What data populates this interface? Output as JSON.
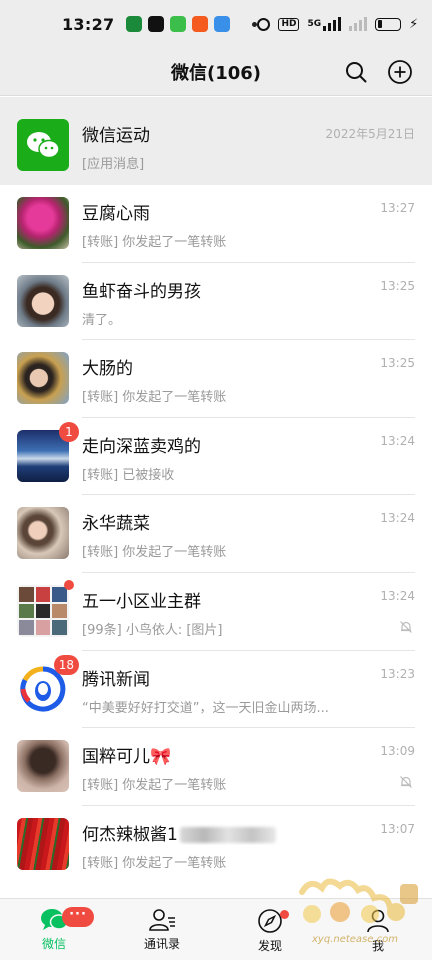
{
  "status_bar": {
    "time": "13:27",
    "network": "5G",
    "hd": "HD"
  },
  "header": {
    "title": "微信(106)"
  },
  "pinned": {
    "name": "微信运动",
    "preview": "[应用消息]",
    "time": "2022年5月21日"
  },
  "chats": [
    {
      "name": "豆腐心雨",
      "preview": "[转账] 你发起了一笔转账",
      "time": "13:27"
    },
    {
      "name": "鱼虾奋斗的男孩",
      "preview": "清了。",
      "time": "13:25"
    },
    {
      "name": "大肠的",
      "preview": "[转账] 你发起了一笔转账",
      "time": "13:25"
    },
    {
      "name": "走向深蓝卖鸡的",
      "preview": "[转账] 已被接收",
      "time": "13:24",
      "badge": "1"
    },
    {
      "name": "永华蔬菜",
      "preview": "[转账] 你发起了一笔转账",
      "time": "13:24"
    },
    {
      "name": "五一小区业主群",
      "preview": "[99条] 小鸟依人: [图片]",
      "time": "13:24"
    },
    {
      "name": "腾讯新闻",
      "preview": "“中美要好好打交道”，这一天旧金山两场...",
      "time": "13:23",
      "badge": "18"
    },
    {
      "name": "国粹可儿🎀",
      "preview": "[转账] 你发起了一笔转账",
      "time": "13:09"
    },
    {
      "name": "何杰辣椒酱1",
      "preview": "[转账] 你发起了一笔转账",
      "time": "13:07"
    }
  ],
  "tabbar": {
    "tabs": [
      {
        "label": "微信",
        "badge": "···"
      },
      {
        "label": "通讯录"
      },
      {
        "label": "发现"
      },
      {
        "label": "我"
      }
    ]
  },
  "watermark": {
    "text": "xyq.netease.com"
  },
  "colors": {
    "accent": "#07c160",
    "badge": "#f04b41",
    "header_bg": "#ededed"
  }
}
